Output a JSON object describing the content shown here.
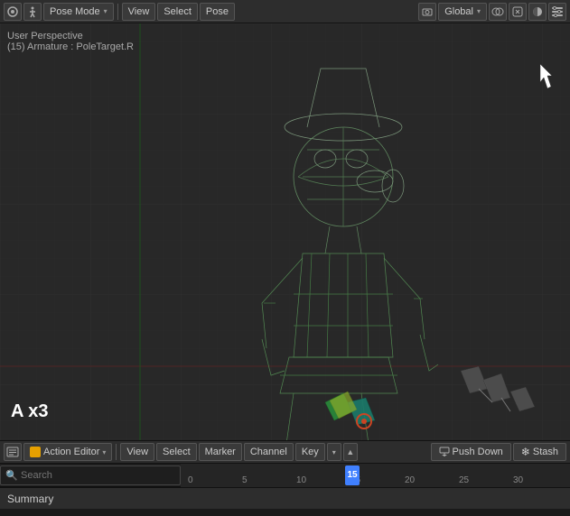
{
  "top_toolbar": {
    "mode_label": "Pose Mode",
    "view_label": "View",
    "select_label": "Select",
    "pose_label": "Pose",
    "global_label": "Global",
    "icons": [
      "⚙",
      "🔧",
      "◻"
    ]
  },
  "viewport": {
    "perspective_label": "User Perspective",
    "armature_label": "(15) Armature : PoleTarget.R",
    "ax3_label": "A x3"
  },
  "bottom_toolbar": {
    "action_editor_label": "Action Editor",
    "view_label": "View",
    "select_label": "Select",
    "marker_label": "Marker",
    "channel_label": "Channel",
    "key_label": "Key",
    "push_down_label": "Push Down",
    "stash_label": "Stash"
  },
  "timeline": {
    "search_placeholder": "Search",
    "frame_current": "15",
    "frames": [
      "0",
      "5",
      "10",
      "15",
      "20",
      "25",
      "30"
    ]
  },
  "summary_bar": {
    "label": "Summary"
  }
}
